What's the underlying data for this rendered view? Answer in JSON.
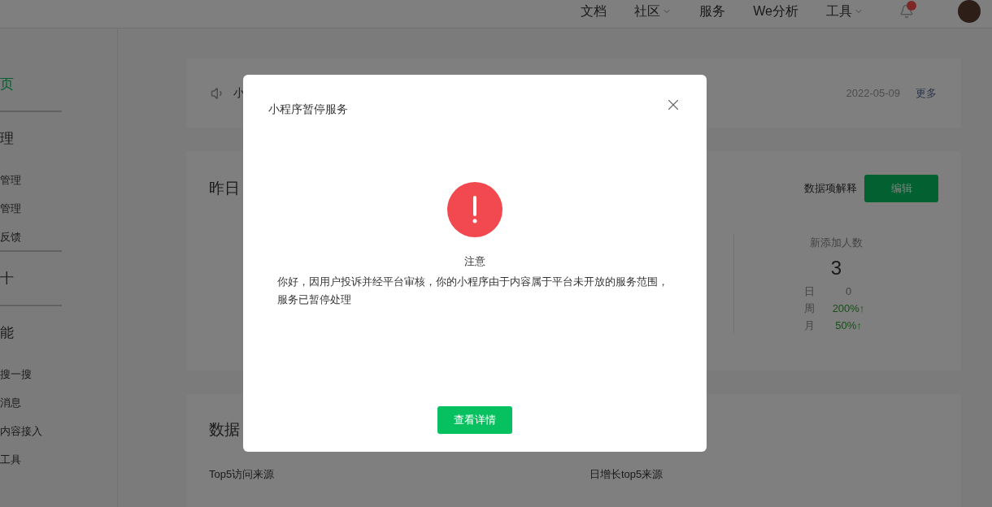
{
  "header": {
    "nav": [
      {
        "label": "文档",
        "dropdown": false
      },
      {
        "label": "社区",
        "dropdown": true
      },
      {
        "label": "服务",
        "dropdown": false
      },
      {
        "label": "We分析",
        "dropdown": false
      },
      {
        "label": "工具",
        "dropdown": true
      }
    ],
    "notifications": {
      "unread": true
    }
  },
  "sidebar": {
    "items": [
      {
        "kind": "heading",
        "label": "页",
        "selected": true,
        "divider": true
      },
      {
        "kind": "heading",
        "label": "理",
        "selected": false,
        "divider": false
      },
      {
        "kind": "item",
        "label": "管理",
        "selected": false,
        "divider": false
      },
      {
        "kind": "item",
        "label": "管理",
        "selected": false,
        "divider": false
      },
      {
        "kind": "item",
        "label": "反馈",
        "selected": false,
        "divider": true
      },
      {
        "kind": "heading",
        "label": "十",
        "selected": false,
        "divider": true
      },
      {
        "kind": "heading",
        "label": "能",
        "selected": false,
        "divider": false
      },
      {
        "kind": "item",
        "label": "搜一搜",
        "selected": false,
        "divider": false
      },
      {
        "kind": "item",
        "label": "消息",
        "selected": false,
        "divider": false
      },
      {
        "kind": "item",
        "label": "内容接入",
        "selected": false,
        "divider": false
      },
      {
        "kind": "item",
        "label": "工具",
        "selected": false,
        "divider": false
      }
    ]
  },
  "notice": {
    "text": "小",
    "date": "2022-05-09",
    "more": "更多"
  },
  "yesterday": {
    "title": "昨日",
    "explain": "数据项解释",
    "edit": "编辑",
    "stat": {
      "label": "新添加人数",
      "value": "3",
      "rows": [
        {
          "label": "日",
          "value": "0",
          "kind": "flat"
        },
        {
          "label": "周",
          "value": "200%↑",
          "kind": "up"
        },
        {
          "label": "月",
          "value": "50%↑",
          "kind": "up"
        }
      ]
    }
  },
  "sources": {
    "title": "数据",
    "left": "Top5访问来源",
    "right": "日增长top5来源"
  },
  "dialog": {
    "title": "小程序暂停服务",
    "heading": "注意",
    "message": "你好，因用户投诉并经平台审核，你的小程序由于内容属于平台未开放的服务范围，服务已暂停处理",
    "button": "查看详情"
  }
}
